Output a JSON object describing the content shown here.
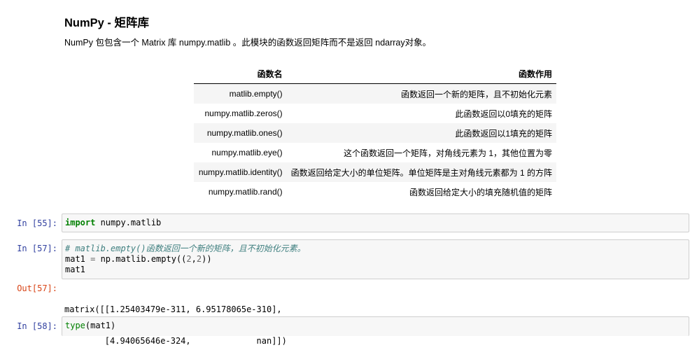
{
  "markdown": {
    "title": "NumPy - 矩阵库",
    "intro": "NumPy 包包含一个 Matrix 库 numpy.matlib 。此模块的函数返回矩阵而不是返回 ndarray对象。",
    "table": {
      "headers": [
        "函数名",
        "函数作用"
      ],
      "rows": [
        [
          "matlib.empty()",
          "函数返回一个新的矩阵，且不初始化元素"
        ],
        [
          "numpy.matlib.zeros()",
          "此函数返回以0填充的矩阵"
        ],
        [
          "numpy.matlib.ones()",
          "此函数返回以1填充的矩阵"
        ],
        [
          "numpy.matlib.eye()",
          "这个函数返回一个矩阵，对角线元素为 1，其他位置为零"
        ],
        [
          "numpy.matlib.identity()",
          "函数返回给定大小的单位矩阵。单位矩阵是主对角线元素都为 1 的方阵"
        ],
        [
          "numpy.matlib.rand()",
          "函数返回给定大小的填充随机值的矩阵"
        ]
      ]
    }
  },
  "cells": {
    "c55": {
      "prompt": "In  [55]:",
      "kw": "import",
      "rest": " numpy.matlib"
    },
    "c57": {
      "prompt": "In  [57]:",
      "comment": "# matlib.empty()函数返回一个新的矩阵，且不初始化元素。",
      "line2_a": "mat1 ",
      "line2_op": "=",
      "line2_b": " np.matlib.empty((",
      "line2_n1": "2",
      "line2_c": ",",
      "line2_n2": "2",
      "line2_d": "))",
      "line3": "mat1",
      "out_prompt": "Out[57]:",
      "out_line1": "matrix([[1.25403479e-311, 6.95178065e-310],",
      "out_line2": "        [4.94065646e-324,             nan]])"
    },
    "c58": {
      "prompt": "In  [58]:",
      "fn": "type",
      "rest": "(mat1)"
    }
  },
  "colors": {
    "in_prompt": "#303f9f",
    "out_prompt": "#d84315",
    "keyword": "#008000",
    "comment": "#408080"
  }
}
